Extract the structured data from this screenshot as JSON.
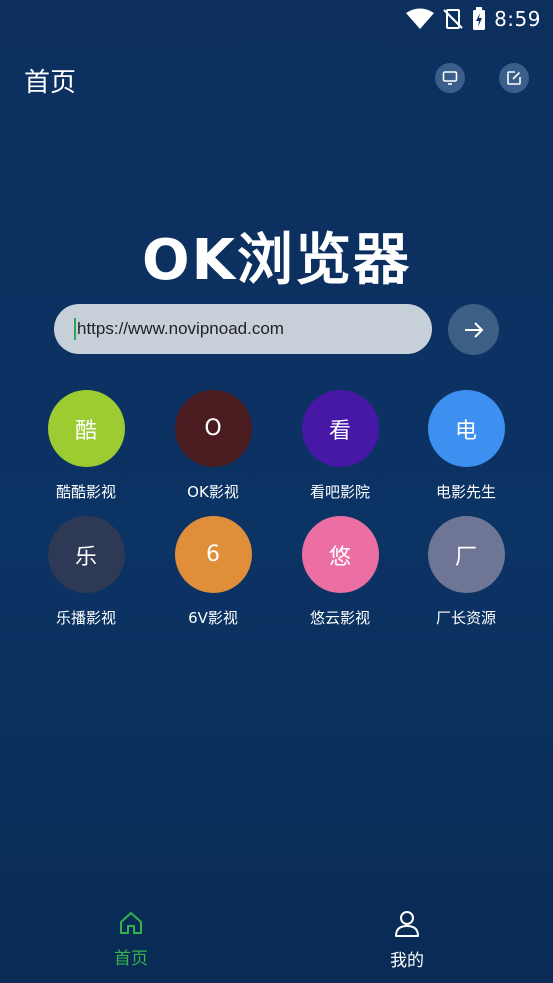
{
  "status_bar": {
    "time": "8:59"
  },
  "header": {
    "title": "首页"
  },
  "logo": {
    "text": "OK浏览器"
  },
  "search": {
    "url": "https://www.novipnoad.com"
  },
  "shortcuts": [
    {
      "glyph": "酷",
      "label": "酷酷影视",
      "color": "#9ccb32"
    },
    {
      "glyph": "O",
      "label": "OK影视",
      "color": "#4a1c1f"
    },
    {
      "glyph": "看",
      "label": "看吧影院",
      "color": "#4717a6"
    },
    {
      "glyph": "电",
      "label": "电影先生",
      "color": "#3d8ff0"
    },
    {
      "glyph": "乐",
      "label": "乐播影视",
      "color": "#2e3a55"
    },
    {
      "glyph": "6",
      "label": "6V影视",
      "color": "#e08e3a"
    },
    {
      "glyph": "悠",
      "label": "悠云影视",
      "color": "#ec6fa3"
    },
    {
      "glyph": "厂",
      "label": "厂长资源",
      "color": "#6f7594"
    }
  ],
  "bottom_nav": {
    "home_label": "首页",
    "mine_label": "我的",
    "active_color": "#35b24d"
  }
}
